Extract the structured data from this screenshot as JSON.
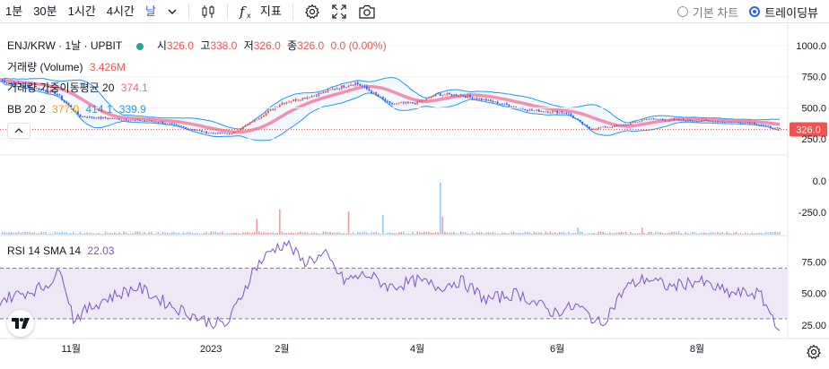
{
  "toolbar": {
    "intervals": [
      {
        "label": "1분"
      },
      {
        "label": "30분"
      },
      {
        "label": "1시간"
      },
      {
        "label": "4시간"
      },
      {
        "label": "날",
        "active": true
      }
    ],
    "indicators_label": "지표",
    "icons": [
      "chevron-down-icon",
      "candles-icon",
      "function-icon",
      "gear-icon",
      "fullscreen-icon",
      "camera-icon"
    ],
    "chart_modes": [
      {
        "label": "기본 차트",
        "selected": false
      },
      {
        "label": "트레이딩뷰",
        "selected": true
      }
    ]
  },
  "legend": {
    "symbol": "ENJ/KRW · 1날 · UPBIT",
    "open_label": "시",
    "open_value": "326.0",
    "high_label": "고",
    "high_value": "338.0",
    "low_label": "저",
    "low_value": "326.0",
    "close_label": "종",
    "close_value": "326.0",
    "change": "0.0 (0.00%)",
    "volume_label": "거래량 (Volume)",
    "volume_value": "3.426M",
    "vwma_label": "거래량 가중이동평균 20",
    "vwma_value": "374.1",
    "bb_label": "BB 20 2",
    "bb_basis": "377.0",
    "bb_upper": "414.1",
    "bb_lower": "339.9",
    "rsi_label": "RSI 14 SMA 14",
    "rsi_value": "22.03"
  },
  "price_badge": "326.0",
  "colors": {
    "up": "#ef5350",
    "down": "#2962ff",
    "bb": "#2196f3",
    "vwma": "#f48fb1",
    "bb_basis": "#ff9800",
    "rsi": "#7e57c2",
    "rsi_band": "#ede7f6",
    "price_line": "#ef5350"
  },
  "chart_data": [
    {
      "type": "candlestick",
      "pane": "price",
      "x": [
        "11월",
        "2023",
        "2월",
        "4월",
        "6월",
        "8월"
      ],
      "price_keys": [
        {
          "x": "2022-10-01",
          "y": 720
        },
        {
          "x": "2022-10-25",
          "y": 620
        },
        {
          "x": "2022-11-05",
          "y": 430
        },
        {
          "x": "2022-11-20",
          "y": 410
        },
        {
          "x": "2022-12-10",
          "y": 385
        },
        {
          "x": "2022-12-30",
          "y": 300
        },
        {
          "x": "2023-01-10",
          "y": 290
        },
        {
          "x": "2023-01-20",
          "y": 400
        },
        {
          "x": "2023-02-01",
          "y": 540
        },
        {
          "x": "2023-02-15",
          "y": 600
        },
        {
          "x": "2023-02-25",
          "y": 660
        },
        {
          "x": "2023-03-05",
          "y": 700
        },
        {
          "x": "2023-03-10",
          "y": 650
        },
        {
          "x": "2023-03-20",
          "y": 530
        },
        {
          "x": "2023-04-01",
          "y": 540
        },
        {
          "x": "2023-04-10",
          "y": 610
        },
        {
          "x": "2023-04-20",
          "y": 600
        },
        {
          "x": "2023-05-01",
          "y": 560
        },
        {
          "x": "2023-05-20",
          "y": 480
        },
        {
          "x": "2023-06-05",
          "y": 460
        },
        {
          "x": "2023-06-15",
          "y": 330
        },
        {
          "x": "2023-06-30",
          "y": 360
        },
        {
          "x": "2023-07-10",
          "y": 410
        },
        {
          "x": "2023-07-25",
          "y": 400
        },
        {
          "x": "2023-08-10",
          "y": 390
        },
        {
          "x": "2023-08-25",
          "y": 380
        },
        {
          "x": "2023-09-06",
          "y": 326
        }
      ],
      "y_ticks": [
        1000.0,
        750.0,
        500.0,
        250.0
      ],
      "last_price": 326.0,
      "ylim": [
        200,
        1100
      ]
    },
    {
      "type": "bar",
      "pane": "volume",
      "y_ticks": [
        0.0,
        -250.0
      ]
    },
    {
      "type": "line",
      "pane": "rsi",
      "name": "RSI 14",
      "rsi_keys": [
        {
          "x": "2022-10-01",
          "y": 45
        },
        {
          "x": "2022-10-20",
          "y": 55
        },
        {
          "x": "2022-10-28",
          "y": 68
        },
        {
          "x": "2022-11-02",
          "y": 30
        },
        {
          "x": "2022-11-15",
          "y": 45
        },
        {
          "x": "2022-11-30",
          "y": 55
        },
        {
          "x": "2022-12-15",
          "y": 40
        },
        {
          "x": "2022-12-30",
          "y": 28
        },
        {
          "x": "2023-01-08",
          "y": 25
        },
        {
          "x": "2023-01-20",
          "y": 70
        },
        {
          "x": "2023-01-28",
          "y": 85
        },
        {
          "x": "2023-02-03",
          "y": 90
        },
        {
          "x": "2023-02-10",
          "y": 75
        },
        {
          "x": "2023-02-20",
          "y": 80
        },
        {
          "x": "2023-02-28",
          "y": 60
        },
        {
          "x": "2023-03-10",
          "y": 65
        },
        {
          "x": "2023-03-20",
          "y": 55
        },
        {
          "x": "2023-04-01",
          "y": 60
        },
        {
          "x": "2023-04-10",
          "y": 55
        },
        {
          "x": "2023-04-20",
          "y": 60
        },
        {
          "x": "2023-05-01",
          "y": 45
        },
        {
          "x": "2023-05-15",
          "y": 50
        },
        {
          "x": "2023-05-30",
          "y": 35
        },
        {
          "x": "2023-06-10",
          "y": 40
        },
        {
          "x": "2023-06-20",
          "y": 25
        },
        {
          "x": "2023-07-01",
          "y": 55
        },
        {
          "x": "2023-07-10",
          "y": 62
        },
        {
          "x": "2023-07-20",
          "y": 55
        },
        {
          "x": "2023-08-01",
          "y": 60
        },
        {
          "x": "2023-08-15",
          "y": 50
        },
        {
          "x": "2023-08-28",
          "y": 50
        },
        {
          "x": "2023-09-06",
          "y": 22
        }
      ],
      "y_ticks": [
        75.0,
        50.0,
        25.0
      ],
      "bands": [
        30,
        70
      ],
      "last_value": 22.03,
      "ylim": [
        15,
        95
      ]
    }
  ]
}
